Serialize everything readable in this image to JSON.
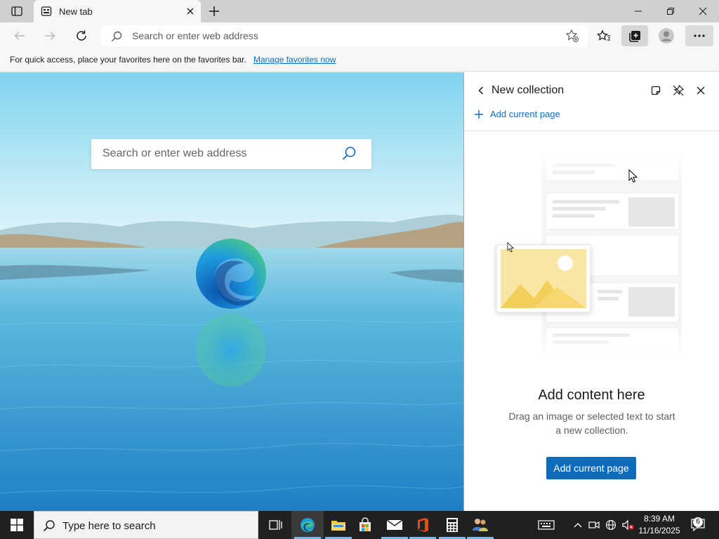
{
  "tab": {
    "title": "New tab"
  },
  "toolbar": {
    "address_placeholder": "Search or enter web address"
  },
  "favorites_bar": {
    "message": "For quick access, place your favorites here on the favorites bar.",
    "link": "Manage favorites now"
  },
  "ntp": {
    "search_placeholder": "Search or enter web address"
  },
  "collections": {
    "title": "New collection",
    "add_current_page_link": "Add current page",
    "empty_heading": "Add content here",
    "empty_description": "Drag an image or selected text to start a new collection.",
    "add_button": "Add current page"
  },
  "taskbar": {
    "search_placeholder": "Type here to search",
    "time": "8:39 AM",
    "date": "11/16/2025",
    "notification_count": "6"
  },
  "colors": {
    "accent": "#0f6cbd",
    "tabbar": "#cfd0d2",
    "taskbar": "#202020"
  }
}
